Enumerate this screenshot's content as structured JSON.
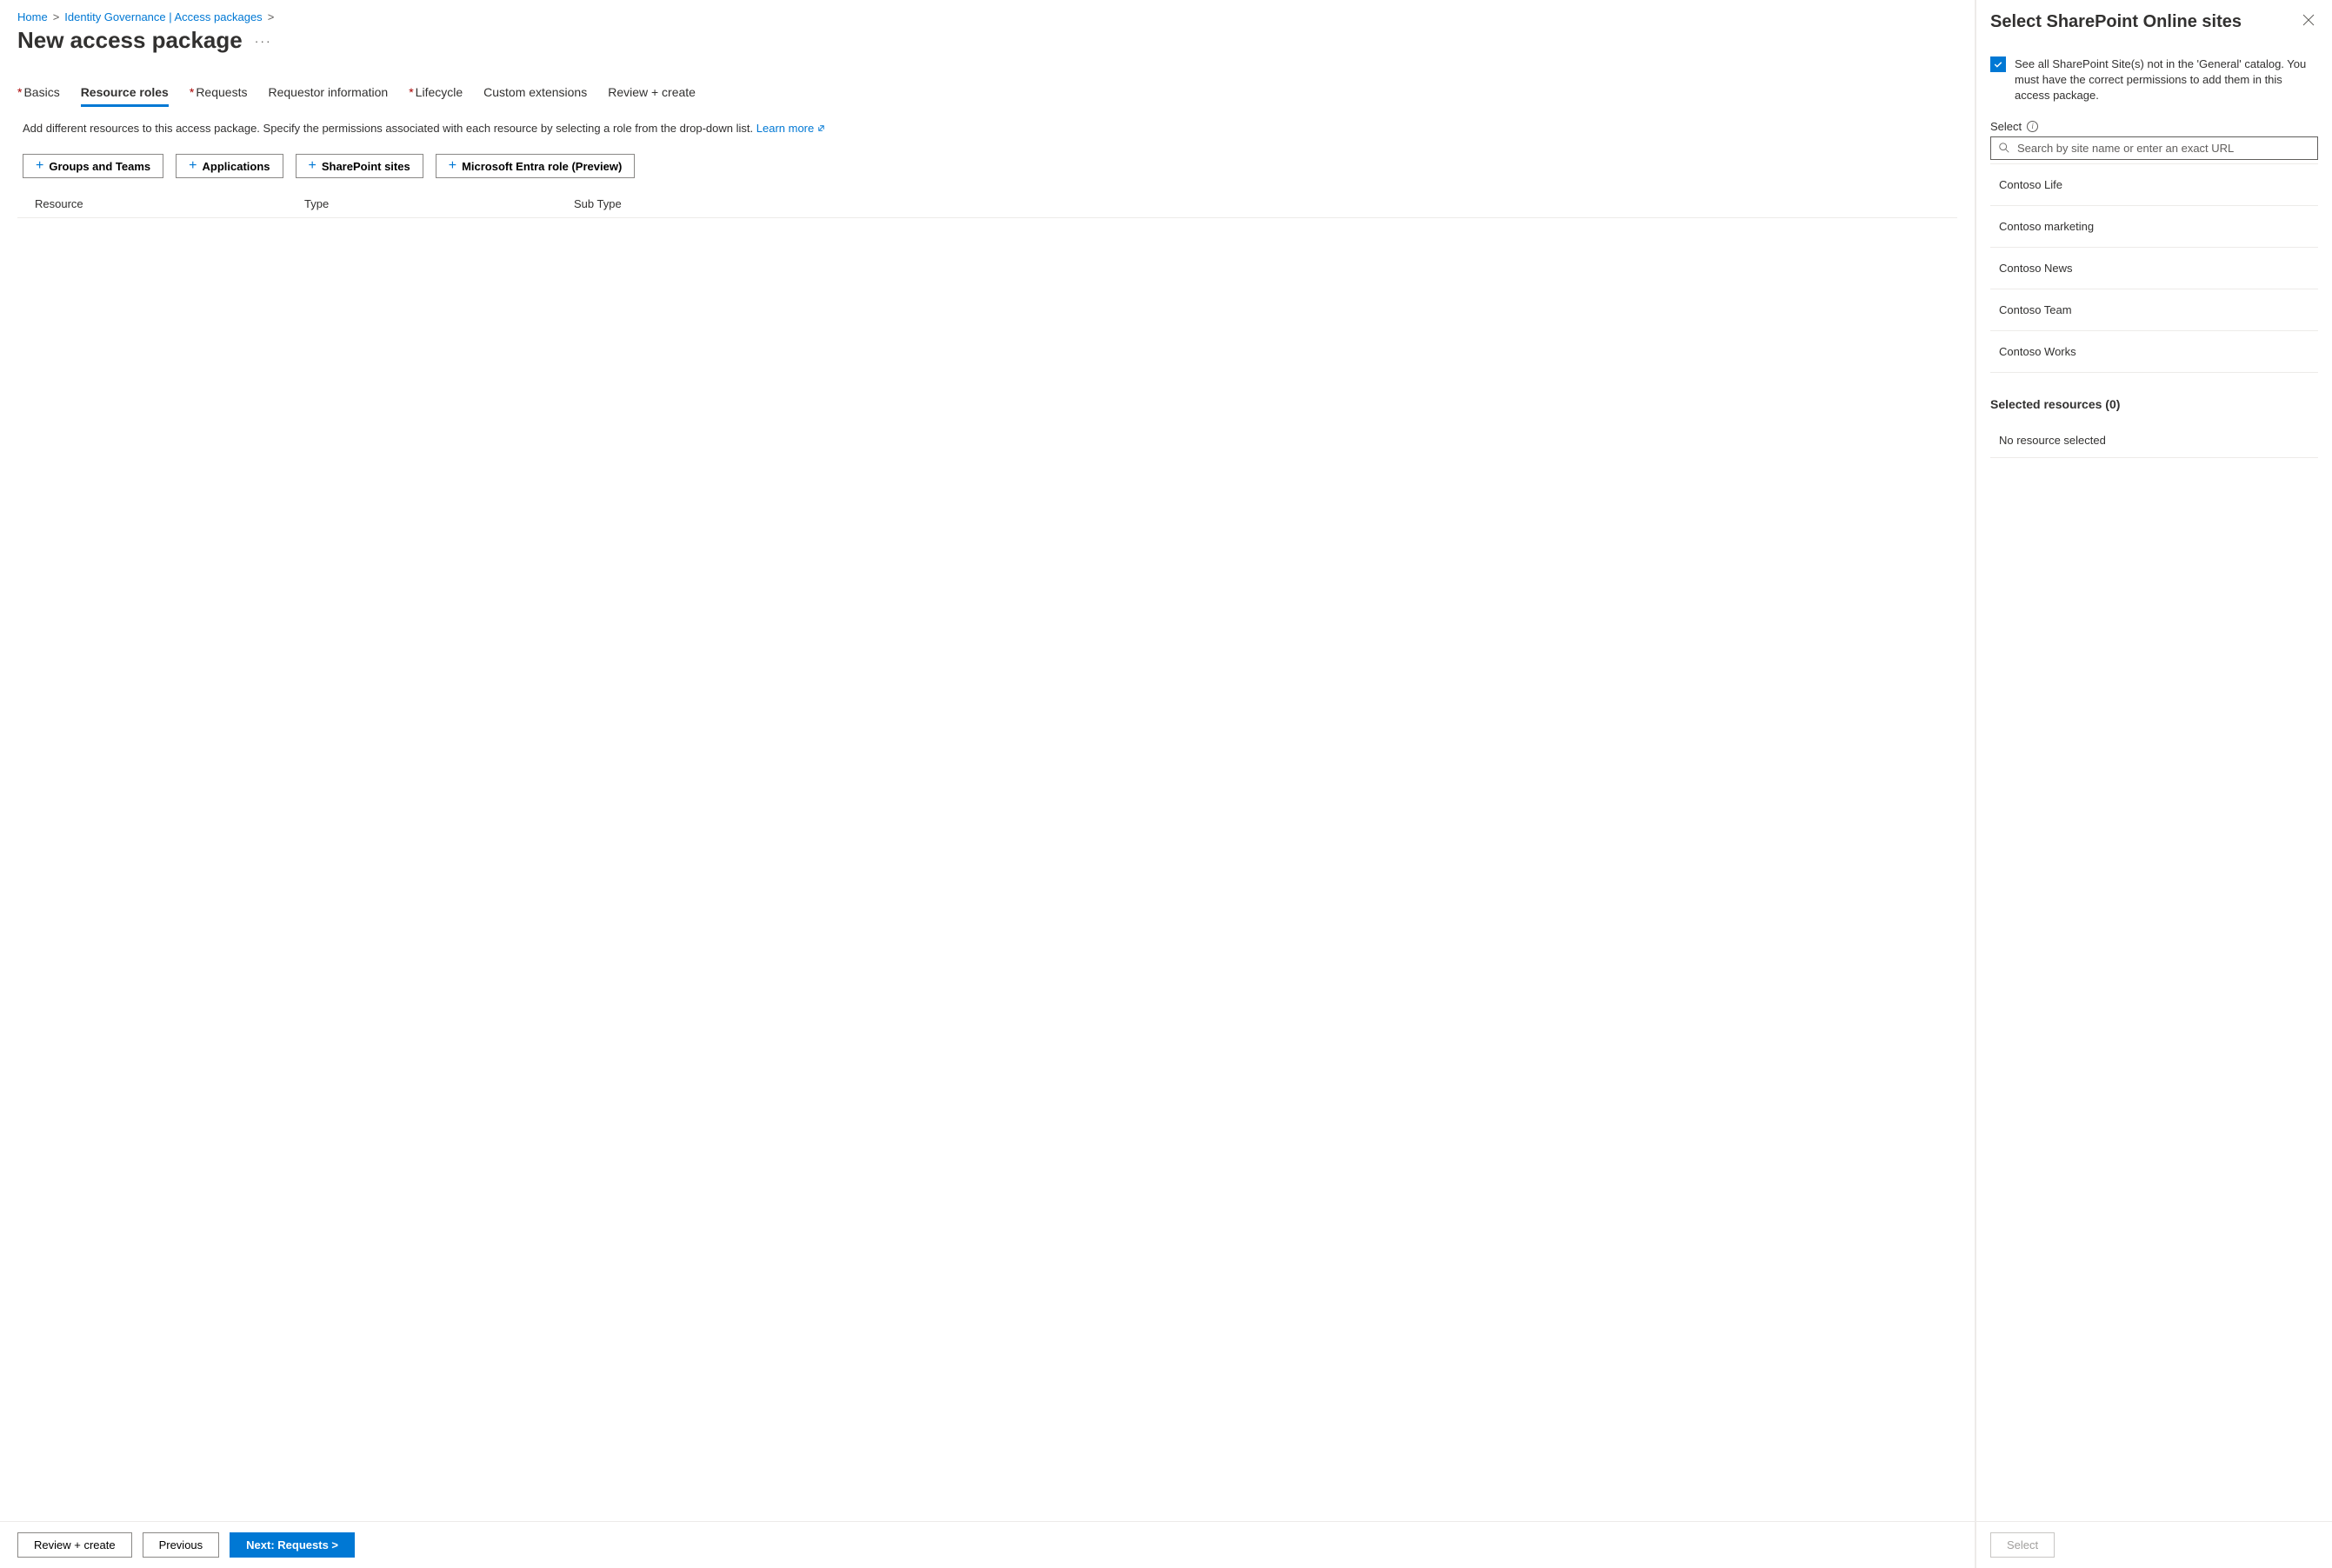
{
  "breadcrumb": {
    "home": "Home",
    "identity": "Identity Governance | Access packages"
  },
  "page_title": "New access package",
  "tabs": [
    {
      "label": "Basics",
      "required": true,
      "active": false
    },
    {
      "label": "Resource roles",
      "required": false,
      "active": true
    },
    {
      "label": "Requests",
      "required": true,
      "active": false
    },
    {
      "label": "Requestor information",
      "required": false,
      "active": false
    },
    {
      "label": "Lifecycle",
      "required": true,
      "active": false
    },
    {
      "label": "Custom extensions",
      "required": false,
      "active": false
    },
    {
      "label": "Review + create",
      "required": false,
      "active": false
    }
  ],
  "description": "Add different resources to this access package. Specify the permissions associated with each resource by selecting a role from the drop-down list.",
  "learn_more": "Learn more",
  "add_buttons": {
    "groups": "Groups and Teams",
    "applications": "Applications",
    "sharepoint": "SharePoint sites",
    "entra": "Microsoft Entra role (Preview)"
  },
  "table": {
    "resource": "Resource",
    "type": "Type",
    "subtype": "Sub Type"
  },
  "footer": {
    "review": "Review + create",
    "previous": "Previous",
    "next": "Next: Requests >"
  },
  "panel": {
    "title": "Select SharePoint Online sites",
    "checkbox_label": "See all SharePoint Site(s) not in the 'General' catalog. You must have the correct permissions to add them in this access package.",
    "select_label": "Select",
    "search_placeholder": "Search by site name or enter an exact URL",
    "sites": [
      "Contoso Life",
      "Contoso marketing",
      "Contoso News",
      "Contoso Team",
      "Contoso Works"
    ],
    "selected_label": "Selected resources (0)",
    "no_resource": "No resource selected",
    "select_button": "Select"
  }
}
